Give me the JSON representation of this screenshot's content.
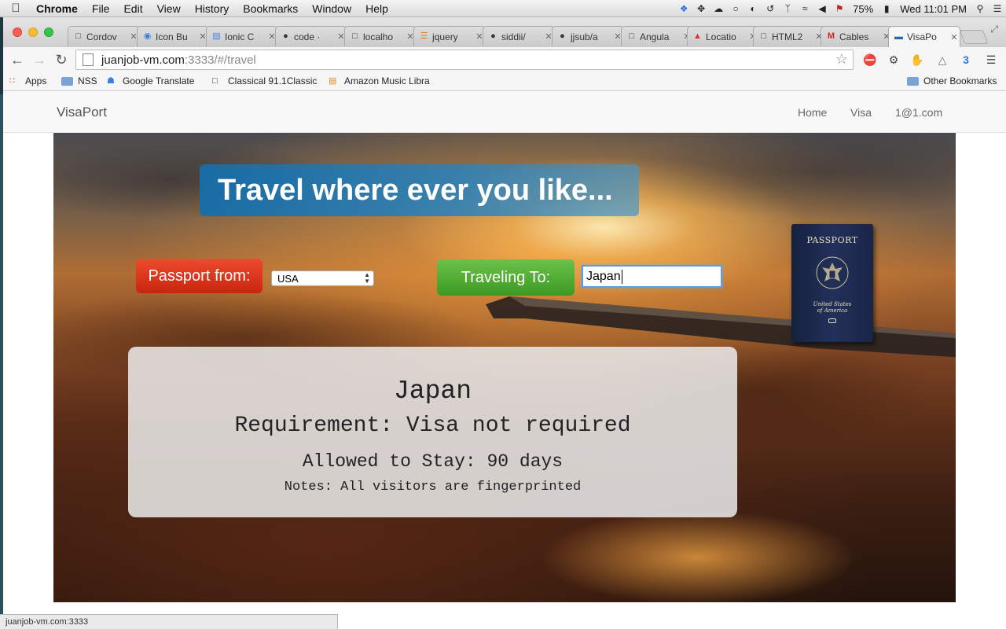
{
  "menubar": {
    "app": "Chrome",
    "items": [
      "File",
      "Edit",
      "View",
      "History",
      "Bookmarks",
      "Window",
      "Help"
    ],
    "battery": "75%",
    "clock": "Wed 11:01 PM"
  },
  "tabs": [
    {
      "label": "Cordov",
      "icon": "page-icon"
    },
    {
      "label": "Icon Bu",
      "icon": "ionic-icon"
    },
    {
      "label": "Ionic C",
      "icon": "docs-icon"
    },
    {
      "label": "code ·",
      "icon": "github-icon"
    },
    {
      "label": "localho",
      "icon": "page-icon"
    },
    {
      "label": "jquery",
      "icon": "stackoverflow-icon"
    },
    {
      "label": "siddii/",
      "icon": "github-icon"
    },
    {
      "label": "jjsub/a",
      "icon": "github-icon"
    },
    {
      "label": "Angula",
      "icon": "page-icon"
    },
    {
      "label": "Locatio",
      "icon": "flame-icon"
    },
    {
      "label": "HTML2",
      "icon": "page-icon"
    },
    {
      "label": "Cables",
      "icon": "gmail-icon"
    },
    {
      "label": "VisaPo",
      "icon": "visaport-icon",
      "active": true
    }
  ],
  "address": {
    "host": "juanjob-vm.com",
    "path": ":3333/#/travel"
  },
  "bookmarks": {
    "items": [
      "Apps",
      "NSS",
      "Google Translate",
      "Classical 91.1Classic",
      "Amazon Music Libra"
    ],
    "other": "Other Bookmarks"
  },
  "site": {
    "brand": "VisaPort",
    "nav": [
      "Home",
      "Visa",
      "1@1.com"
    ]
  },
  "hero": {
    "headline": "Travel where ever you like...",
    "passport_label": "Passport from:",
    "passport_value": "USA",
    "traveling_label": "Traveling To:",
    "traveling_value": "Japan"
  },
  "passport_image": {
    "title": "PASSPORT",
    "country_line1": "United States",
    "country_line2": "of America"
  },
  "result": {
    "country": "Japan",
    "requirement": "Requirement: Visa not required",
    "stay": "Allowed to Stay: 90 days",
    "notes": "Notes: All visitors are fingerprinted"
  },
  "statusbar": {
    "url": "juanjob-vm.com:3333"
  },
  "colors": {
    "headline_bg": "#156eaa",
    "passport_pill": "#d9321a",
    "traveling_pill": "#52ad35",
    "focus_ring": "#5e9be3"
  }
}
